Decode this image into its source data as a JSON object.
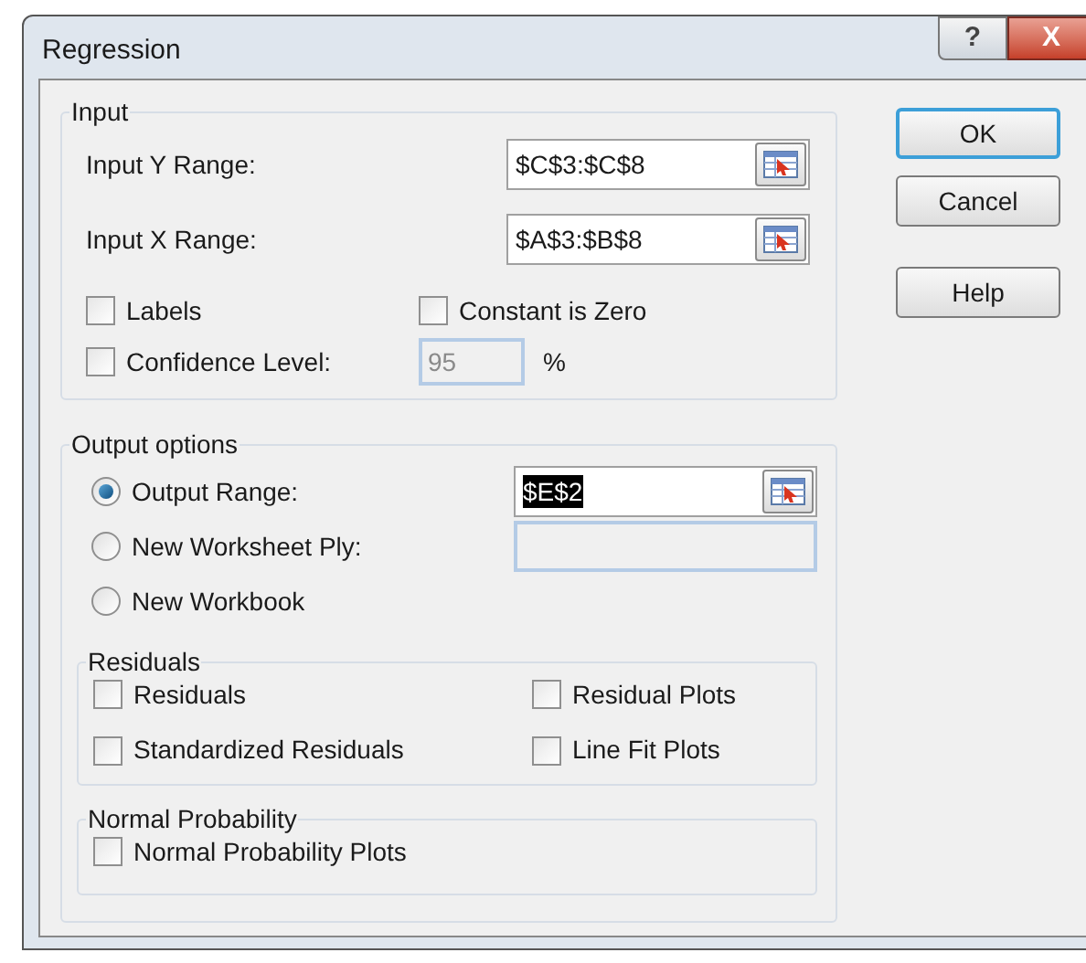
{
  "window": {
    "title": "Regression",
    "help_glyph": "?",
    "close_glyph": "X"
  },
  "input": {
    "title": "Input",
    "ranges": [
      {
        "label": "Input Y Range:",
        "value": "$C$3:$C$8"
      },
      {
        "label": "Input X Range:",
        "value": "$A$3:$B$8"
      }
    ],
    "options": [
      {
        "label": "Labels",
        "checked": false
      },
      {
        "label": "Constant is Zero",
        "checked": false
      },
      {
        "label": "Confidence Level:",
        "checked": false
      }
    ],
    "confidence": {
      "value": "95",
      "disabled": true
    },
    "percent": "%"
  },
  "output": {
    "title": "Output options",
    "choices": [
      {
        "kind": "range",
        "label": "Output Range:",
        "selected": true,
        "value": "$E$2",
        "highlighted": true
      },
      {
        "kind": "ply",
        "label": "New Worksheet Ply:",
        "selected": false
      },
      {
        "kind": "plain",
        "label": "New Workbook",
        "selected": false
      }
    ],
    "groups": [
      {
        "title": "Residuals",
        "options": [
          {
            "label": "Residuals",
            "checked": false
          },
          {
            "label": "Residual Plots",
            "checked": false
          },
          {
            "label": "Standardized Residuals",
            "checked": false
          },
          {
            "label": "Line Fit Plots",
            "checked": false
          }
        ]
      },
      {
        "title": "Normal Probability",
        "options": [
          {
            "label": "Normal Probability Plots",
            "checked": false
          }
        ]
      }
    ]
  },
  "buttons": [
    {
      "label": "OK",
      "default": true
    },
    {
      "label": "Cancel",
      "default": false
    },
    {
      "label": "Help",
      "default": false
    }
  ]
}
